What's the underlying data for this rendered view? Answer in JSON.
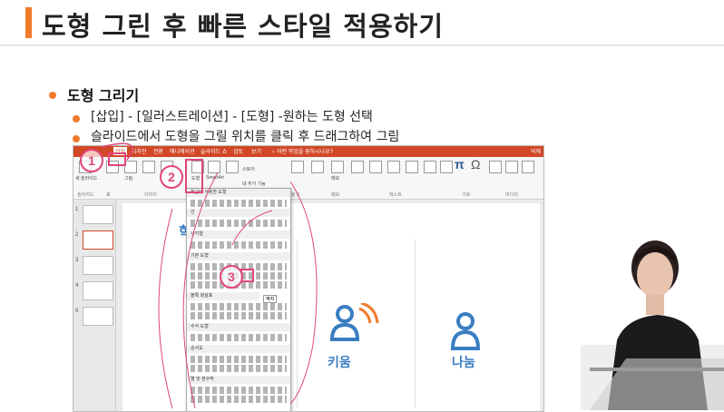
{
  "slide": {
    "title": "도형 그린 후 빠른 스타일 적용하기",
    "heading": "도형 그리기",
    "bullets": [
      "[삽입] - [일러스트레이션] - [도형] -원하는 도형 선택",
      "슬라이드에서 도형을 그릴 위치를 클릭 후 드래그하여 그림"
    ]
  },
  "colors": {
    "accent": "#f07a2a",
    "annotation": "#e0457b",
    "ppt_tab": "#d24726",
    "icon_blue": "#3a7ec2"
  },
  "ppt": {
    "tabs": [
      "삽입",
      "디자인",
      "전환",
      "애니메이션",
      "슬라이드 쇼",
      "검토",
      "보기",
      "♀ 어떤 작업을 원하시나요?",
      "덕해"
    ],
    "ribbon": {
      "groups": [
        "슬라이드",
        "표",
        "이미지",
        "일러스트레이션",
        "추가 기능",
        "링크",
        "메모",
        "텍스트",
        "기호",
        "미디어"
      ],
      "buttons": [
        "새 슬라이드",
        "표",
        "그림",
        "온라인 그림",
        "스크린샷",
        "사진 앨범",
        "도형",
        "SmartArt",
        "차트",
        "스토어",
        "내 추가 기능",
        "하이퍼링크",
        "실행",
        "메모",
        "텍스트 상자",
        "머리글/바닥글",
        "WordArt",
        "날짜 및 시간",
        "슬라이드 번호",
        "개체",
        "수식",
        "기호",
        "비디오",
        "오디오",
        "화면 녹화"
      ]
    },
    "thumb_numbers": [
      "1",
      "2",
      "3",
      "4",
      "5"
    ],
    "shape_menu": {
      "sections": [
        "최근에 사용한 도형",
        "선",
        "사각형",
        "기본 도형",
        "블록 화살표",
        "수식 도형",
        "순서도",
        "별 및 현수막"
      ],
      "tooltip": "액자"
    },
    "slide_labels": {
      "left_char": "학",
      "card1": "키움",
      "card2": "나눔"
    }
  },
  "annotations": [
    "1",
    "2",
    "3"
  ]
}
